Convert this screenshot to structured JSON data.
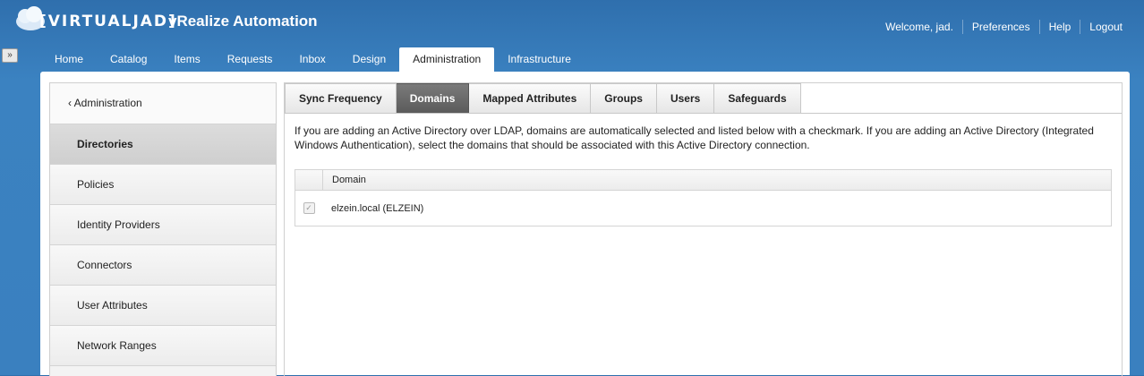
{
  "header": {
    "logo_text": "[VIRTUALJAD]",
    "app_title": "vRealize Automation",
    "welcome": "Welcome, jad.",
    "links": [
      "Preferences",
      "Help",
      "Logout"
    ]
  },
  "expand_label": "»",
  "nav": {
    "items": [
      "Home",
      "Catalog",
      "Items",
      "Requests",
      "Inbox",
      "Design",
      "Administration",
      "Infrastructure"
    ],
    "active": "Administration"
  },
  "sidebar": {
    "back_label": "‹ Administration",
    "items": [
      "Directories",
      "Policies",
      "Identity Providers",
      "Connectors",
      "User Attributes",
      "Network Ranges"
    ],
    "active": "Directories"
  },
  "tabs": {
    "items": [
      "Sync Frequency",
      "Domains",
      "Mapped Attributes",
      "Groups",
      "Users",
      "Safeguards"
    ],
    "active": "Domains"
  },
  "description": "If you are adding an Active Directory over LDAP, domains are automatically selected and listed below with a checkmark. If you are adding an Active Directory (Integrated Windows Authentication), select the domains that should be associated with this Active Directory connection.",
  "table": {
    "header": "Domain",
    "rows": [
      {
        "checked": true,
        "label": "elzein.local (ELZEIN)"
      }
    ]
  },
  "colors": {
    "header_blue": "#3b82c1",
    "tab_active": "#5b5b5b"
  }
}
